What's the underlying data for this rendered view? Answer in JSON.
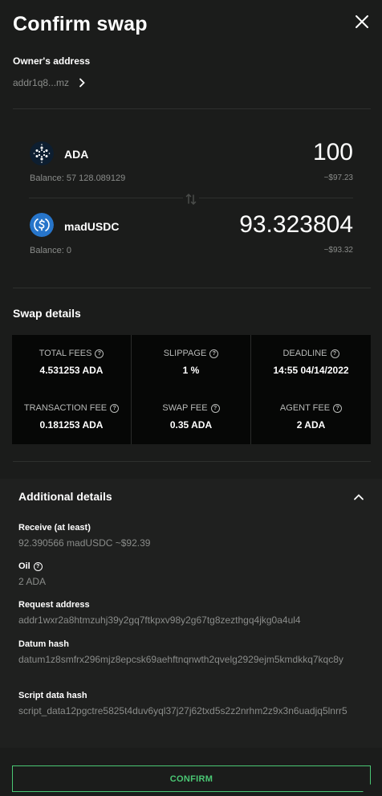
{
  "header": {
    "title": "Confirm swap"
  },
  "owner": {
    "label": "Owner's address",
    "address": "addr1q8...mz"
  },
  "from_token": {
    "symbol": "ADA",
    "balance": "Balance: 57 128.089129",
    "amount": "100",
    "usd": "~$97.23"
  },
  "to_token": {
    "symbol": "madUSDC",
    "balance": "Balance: 0",
    "amount": "93.323804",
    "usd": "~$93.32"
  },
  "swap_details": {
    "title": "Swap details",
    "cells": [
      {
        "label": "TOTAL FEES",
        "value": "4.531253 ADA"
      },
      {
        "label": "SLIPPAGE",
        "value": "1 %"
      },
      {
        "label": "DEADLINE",
        "value": "14:55 04/14/2022"
      },
      {
        "label": "TRANSACTION FEE",
        "value": "0.181253 ADA"
      },
      {
        "label": "SWAP FEE",
        "value": "0.35 ADA"
      },
      {
        "label": "AGENT FEE",
        "value": "2 ADA"
      }
    ]
  },
  "additional": {
    "title": "Additional details",
    "items": [
      {
        "label": "Receive (at least)",
        "value": "92.390566 madUSDC  ~$92.39"
      },
      {
        "label": "Oil",
        "value": "2 ADA"
      },
      {
        "label": "Request address",
        "value": "addr1wxr2a8htmzuhj39y2gq7ftkpxv98y2g67tg8zezthgq4jkg0a4ul4"
      },
      {
        "label": "Datum hash",
        "value": "datum1z8smfrx296mjz8epcsk69aehftnqnwth2qvelg2929ejm5kmdkkq7kqc8y"
      },
      {
        "label": "Script data hash",
        "value": "script_data12pgctre5825t4duv6yql37j27j62txd5s2z2nrhm2z9x3n6uadjq5lnrr5"
      }
    ]
  },
  "actions": {
    "confirm_label": "CONFIRM"
  },
  "colors": {
    "background": "#1b1c1b",
    "accent": "#4ac774",
    "ada_icon": "#0d1e30",
    "usdc_icon": "#2775ca"
  }
}
